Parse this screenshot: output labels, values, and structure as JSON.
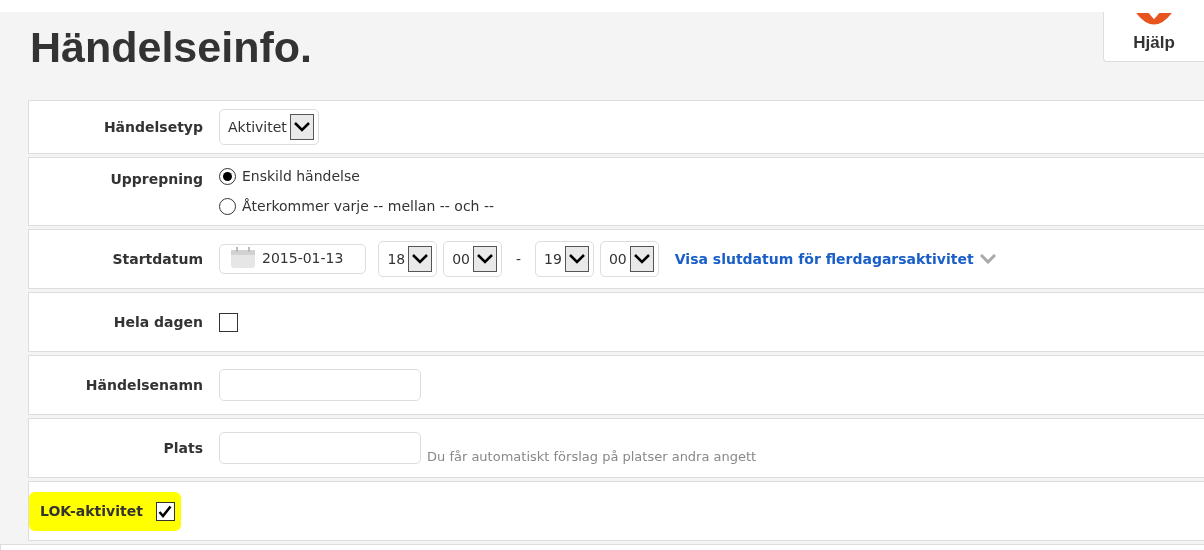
{
  "title": "Händelseinfo.",
  "help_button": {
    "label": "Hjälp"
  },
  "rows": [
    {
      "kind": "select",
      "label": "Händelsetyp",
      "value": "Aktivitet",
      "highlighted": false
    },
    {
      "kind": "radio",
      "label": "Upprepning",
      "highlighted": false,
      "options": [
        {
          "label": "Enskild händelse",
          "selected": true
        },
        {
          "label": "Återkommer varje -- mellan -- och --",
          "selected": false
        }
      ]
    },
    {
      "kind": "datetime",
      "label": "Startdatum",
      "highlighted": false,
      "date": "2015-01-13",
      "start_hour": "18",
      "start_minute": "00",
      "separator": "-",
      "end_hour": "19",
      "end_minute": "00",
      "link": "Visa slutdatum för flerdagarsaktivitet"
    },
    {
      "kind": "checkbox",
      "label": "Hela dagen",
      "checked": false,
      "highlighted": false
    },
    {
      "kind": "text",
      "label": "Händelsenamn",
      "highlighted": false
    },
    {
      "kind": "text",
      "label": "Plats",
      "hint": "Du får automatiskt förslag på platser andra angett",
      "highlighted": false
    },
    {
      "kind": "checkbox",
      "label": "LOK-aktivitet",
      "checked": true,
      "highlighted": true
    }
  ]
}
